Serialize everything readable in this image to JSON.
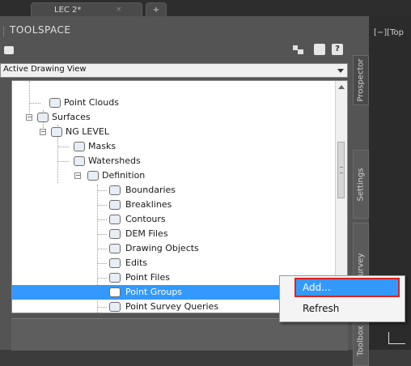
{
  "document_tabs": [
    {
      "label": "LEC 2*",
      "close": "×"
    },
    {
      "label": "+"
    }
  ],
  "toolspace": {
    "title": "TOOLSPACE",
    "help_label": "?",
    "view_selector": {
      "value": "Active Drawing View"
    },
    "side_tabs": [
      "Prospector",
      "Settings",
      "Survey",
      "Toolbox"
    ]
  },
  "tree": [
    {
      "label": "Point Clouds",
      "icon": "point-cloud-icon"
    },
    {
      "label": "Surfaces",
      "icon": "surfaces-icon",
      "expander": "−"
    },
    {
      "label": "NG LEVEL",
      "icon": "surface-icon",
      "expander": "−"
    },
    {
      "label": "Masks",
      "icon": "masks-icon"
    },
    {
      "label": "Watersheds",
      "icon": "watersheds-icon"
    },
    {
      "label": "Definition",
      "icon": "definition-icon",
      "expander": "−"
    },
    {
      "label": "Boundaries",
      "icon": "boundaries-icon"
    },
    {
      "label": "Breaklines",
      "icon": "breaklines-icon"
    },
    {
      "label": "Contours",
      "icon": "contours-icon"
    },
    {
      "label": "DEM Files",
      "icon": "dem-files-icon"
    },
    {
      "label": "Drawing Objects",
      "icon": "drawing-objects-icon"
    },
    {
      "label": "Edits",
      "icon": "edits-icon"
    },
    {
      "label": "Point Files",
      "icon": "point-files-icon"
    },
    {
      "label": "Point Groups",
      "icon": "point-groups-icon",
      "selected": true
    },
    {
      "label": "Point Survey Queries",
      "icon": "point-survey-queries-icon"
    }
  ],
  "viewport": {
    "label": "[−][Top"
  },
  "context_menu": {
    "items": [
      {
        "label": "Add...",
        "highlighted": true
      },
      {
        "label": "Refresh"
      }
    ]
  },
  "colors": {
    "selection": "#3399ff",
    "callout_outline": "#e02020",
    "panel_bg": "#545454"
  }
}
